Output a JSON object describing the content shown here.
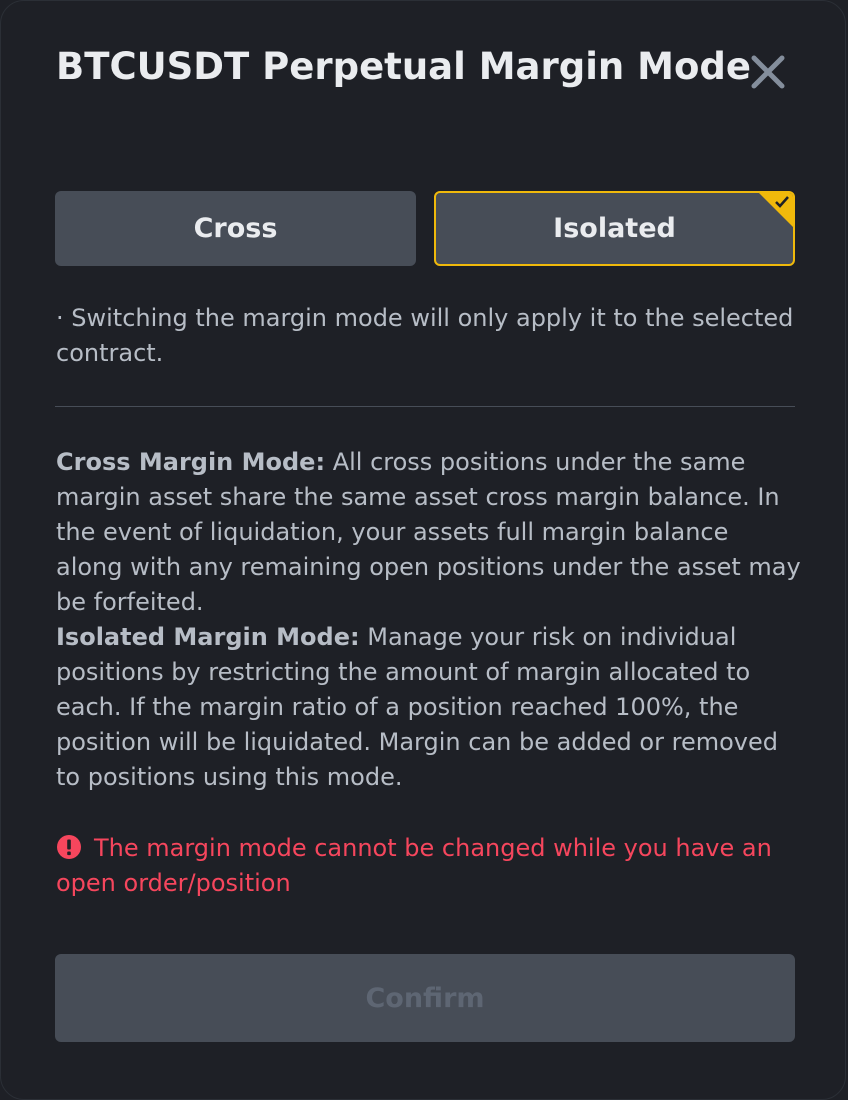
{
  "dialog": {
    "title": "BTCUSDT Perpetual Margin Mode"
  },
  "modes": {
    "cross_label": "Cross",
    "isolated_label": "Isolated",
    "selected": "Isolated"
  },
  "note": "· Switching the margin mode will only apply it to the selected contract.",
  "cross_desc": {
    "heading": "Cross Margin Mode:",
    "body": " All cross positions under the same margin asset share the same asset cross margin balance. In the event of liquidation, your assets full margin balance along with any remaining open positions under the asset may be forfeited."
  },
  "isolated_desc": {
    "heading": "Isolated Margin Mode:",
    "body": " Manage your risk on individual positions by restricting the amount of margin allocated to each. If the margin ratio of a position reached 100%, the position will be liquidated. Margin can be added or removed to positions using this mode."
  },
  "warning": {
    "icon": "exclamation-circle-icon",
    "text": "The margin mode cannot be changed while you have an open order/position"
  },
  "confirm_label": "Confirm",
  "colors": {
    "accent": "#f0b90b",
    "error": "#f6465d",
    "background": "#1e2026",
    "button": "#474d57"
  }
}
